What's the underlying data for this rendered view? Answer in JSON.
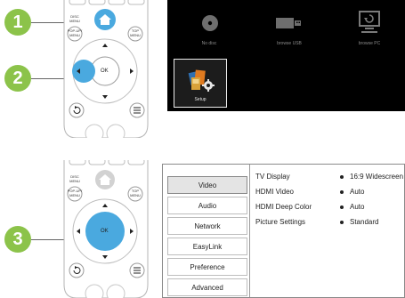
{
  "steps": [
    "1",
    "2",
    "3"
  ],
  "remote_labels": {
    "disc_menu_line1": "DISC",
    "disc_menu_line2": "MENU",
    "popup_line1": "POP-UP/",
    "popup_line2": "MENU",
    "top_menu_line1": "TOP",
    "top_menu_line2": "MENU",
    "ok": "OK"
  },
  "home_menu": {
    "items": [
      "No disc",
      "browse USB",
      "browse PC"
    ],
    "setup": "Setup"
  },
  "settings": {
    "menu": [
      "Video",
      "Audio",
      "Network",
      "EasyLink",
      "Preference",
      "Advanced"
    ],
    "selected": "Video",
    "rows": [
      {
        "name": "TV Display",
        "value": "16:9 Widescreen"
      },
      {
        "name": "HDMI Video",
        "value": "Auto"
      },
      {
        "name": "HDMI Deep Color",
        "value": "Auto"
      },
      {
        "name": "Picture Settings",
        "value": "Standard"
      }
    ]
  },
  "colors": {
    "step": "#8cc34a",
    "highlight": "#4aa9df",
    "screen_bg": "#000000"
  }
}
